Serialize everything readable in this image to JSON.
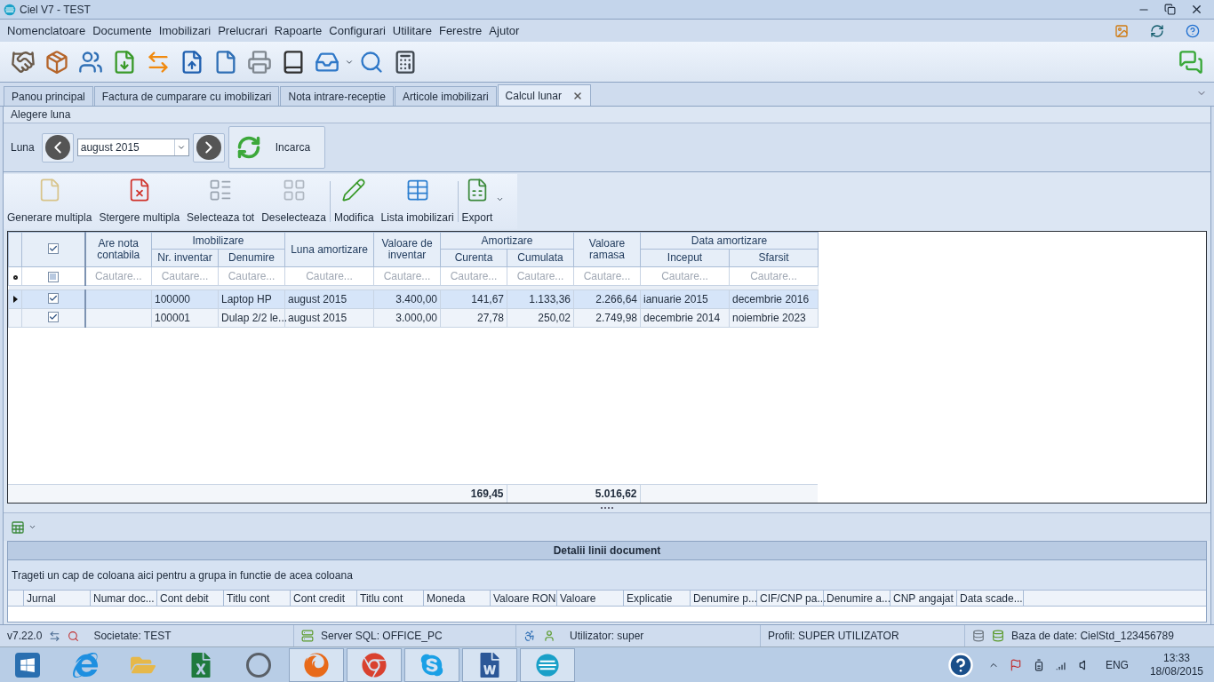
{
  "window": {
    "title": "Ciel V7 - TEST"
  },
  "menu": [
    "Nomenclatoare",
    "Documente",
    "Imobilizari",
    "Prelucrari",
    "Rapoarte",
    "Configurari",
    "Utilitare",
    "Ferestre",
    "Ajutor"
  ],
  "tabs": [
    {
      "label": "Panou principal",
      "selected": false
    },
    {
      "label": "Factura de cumparare cu imobilizari",
      "selected": false
    },
    {
      "label": "Nota intrare-receptie",
      "selected": false
    },
    {
      "label": "Articole imobilizari",
      "selected": false
    },
    {
      "label": "Calcul lunar",
      "selected": true
    }
  ],
  "month_panel": {
    "title": "Alegere luna",
    "label": "Luna",
    "value": "august 2015",
    "load_button": "Incarca"
  },
  "actions": [
    {
      "label": "Generare multipla",
      "kind": "new",
      "dropdown": false
    },
    {
      "label": "Stergere multipla",
      "kind": "delete",
      "dropdown": false
    },
    {
      "label": "Selecteaza tot",
      "kind": "select_all",
      "dropdown": false
    },
    {
      "label": "Deselecteaza",
      "kind": "deselect",
      "dropdown": false
    },
    {
      "label": "Modifica",
      "kind": "edit",
      "dropdown": false
    },
    {
      "label": "Lista imobilizari",
      "kind": "list",
      "dropdown": false
    },
    {
      "label": "Export",
      "kind": "export",
      "dropdown": true
    }
  ],
  "grid": {
    "header_checked": true,
    "filter_checked": false,
    "header": [
      {
        "label": "Are nota contabila",
        "kind": "text",
        "placeholder": "Cautare..."
      },
      {
        "label": "Imobilizare",
        "children": [
          {
            "label": "Nr. inventar",
            "kind": "text",
            "placeholder": "Cautare..."
          },
          {
            "label": "Denumire",
            "kind": "text",
            "placeholder": "Cautare..."
          }
        ]
      },
      {
        "label": "Luna amortizare",
        "kind": "text",
        "placeholder": "Cautare..."
      },
      {
        "label": "Valoare de inventar",
        "kind": "number",
        "placeholder": "Cautare..."
      },
      {
        "label": "Amortizare",
        "children": [
          {
            "label": "Curenta",
            "kind": "number",
            "placeholder": "Cautare...",
            "total": "169,45"
          },
          {
            "label": "Cumulata",
            "kind": "number",
            "placeholder": "Cautare..."
          }
        ]
      },
      {
        "label": "Valoare ramasa",
        "kind": "number",
        "placeholder": "Cautare...",
        "total": "5.016,62"
      },
      {
        "label": "Data amortizare",
        "children": [
          {
            "label": "Inceput",
            "kind": "text",
            "placeholder": "Cautare..."
          },
          {
            "label": "Sfarsit",
            "kind": "text",
            "placeholder": "Cautare..."
          }
        ]
      }
    ],
    "rows": [
      {
        "selected": true,
        "checked": true,
        "cells": [
          null,
          "100000",
          "Laptop HP",
          "august 2015",
          "3.400,00",
          "141,67",
          "1.133,36",
          "2.266,64",
          "ianuarie 2015",
          "decembrie 2016"
        ]
      },
      {
        "selected": false,
        "checked": true,
        "cells": [
          null,
          "100001",
          "Dulap 2/2 le...",
          "august 2015",
          "3.000,00",
          "27,78",
          "250,02",
          "2.749,98",
          "decembrie 2014",
          "noiembrie 2023"
        ]
      }
    ]
  },
  "details": {
    "title": "Detalii linii document",
    "group_hint": "Trageti un cap de coloana aici pentru a grupa in functie de acea coloana",
    "columns": [
      "Jurnal",
      "Numar doc...",
      "Cont debit",
      "Titlu cont",
      "Cont credit",
      "Titlu cont",
      "Moneda",
      "Valoare RON",
      "Valoare",
      "Explicatie",
      "Denumire p...",
      "CIF/CNP pa...",
      "Denumire a...",
      "CNP angajat",
      "Data scade..."
    ]
  },
  "status_bar": [
    "v7.22.0",
    "Societate: TEST",
    "Server SQL: OFFICE_PC",
    "Utilizator: super",
    "Profil: SUPER UTILIZATOR",
    "Baza de date: CielStd_123456789"
  ],
  "taskbar": {
    "apps": [
      {
        "kind": "start",
        "active": false
      },
      {
        "kind": "ie",
        "active": false
      },
      {
        "kind": "explorer",
        "active": false
      },
      {
        "kind": "excel",
        "active": false
      },
      {
        "kind": "hp",
        "active": false
      },
      {
        "kind": "firefox",
        "active": true
      },
      {
        "kind": "chrome",
        "active": true
      },
      {
        "kind": "skype",
        "active": true
      },
      {
        "kind": "word",
        "active": true
      },
      {
        "kind": "ciel",
        "active": true
      }
    ],
    "language": "ENG",
    "time": "13:33",
    "date": "18/08/2015"
  }
}
